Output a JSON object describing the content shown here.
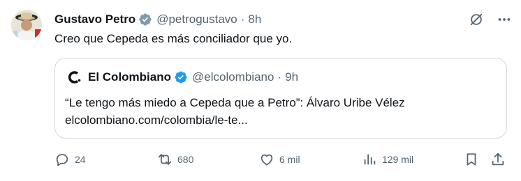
{
  "author": {
    "display_name": "Gustavo Petro",
    "handle": "@petrogustavo",
    "time": "8h",
    "separator": "·"
  },
  "tweet_text": "Creo que Cepeda es más conciliador que yo.",
  "quoted": {
    "display_name": "El Colombiano",
    "handle": "@elcolombiano",
    "time": "9h",
    "separator": "·",
    "text_line_1": "“Le tengo más miedo a Cepeda que a Petro”: Álvaro Uribe Vélez",
    "text_line_2": "elcolombiano.com/colombia/le-te..."
  },
  "actions": {
    "reply_count": "24",
    "retweet_count": "680",
    "like_count": "6 mil",
    "views_count": "129 mil"
  },
  "colors": {
    "verified_blue": "#1d9bf0",
    "verified_gray": "#829aab",
    "muted_text": "#536471",
    "border": "#cfd9de"
  },
  "icons": {
    "grok": "grok-icon",
    "more": "more-icon",
    "reply": "reply-icon",
    "retweet": "retweet-icon",
    "like": "heart-icon",
    "views": "views-icon",
    "bookmark": "bookmark-icon",
    "share": "share-icon"
  }
}
